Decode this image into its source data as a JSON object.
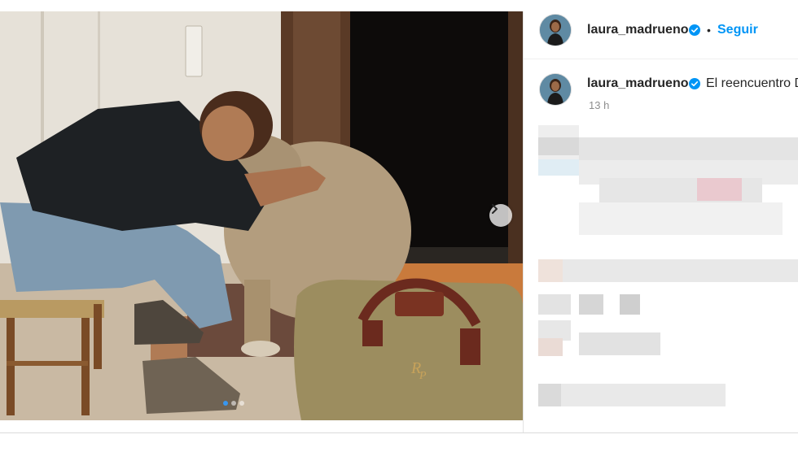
{
  "post": {
    "author": {
      "username": "laura_madrueno",
      "verified": true,
      "avatar": "author-avatar"
    },
    "header": {
      "separator": "•",
      "follow_label": "Seguir"
    },
    "caption": {
      "username": "laura_madrueno",
      "text": "El reencuentro D",
      "time": "13 h"
    },
    "media": {
      "description_icon": "photo",
      "next_icon": "chevron-right-icon",
      "carousel": {
        "count": 3,
        "active": 1
      },
      "bag_monogram": "RP"
    },
    "colors": {
      "accent": "#0095f6",
      "verified": "#0095f6",
      "text": "#262626",
      "muted": "#8e8e8e",
      "active_dot": "#3897f0"
    }
  }
}
